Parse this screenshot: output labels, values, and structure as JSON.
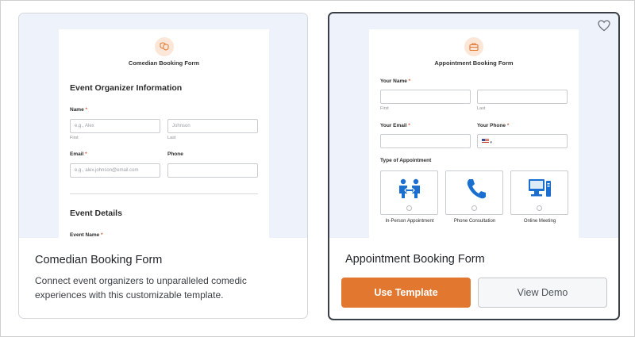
{
  "cards": [
    {
      "preview": {
        "form_title": "Comedian Booking Form",
        "section1": "Event Organizer Information",
        "name_label": "Name",
        "first_placeholder": "e.g., Alex",
        "last_placeholder": "Johnson",
        "first_sub": "First",
        "last_sub": "Last",
        "email_label": "Email",
        "email_placeholder": "e.g., alex.johnson@email.com",
        "phone_label": "Phone",
        "section2": "Event Details",
        "event_name_label": "Event Name",
        "required_mark": "*"
      },
      "title": "Comedian Booking Form",
      "description": "Connect event organizers to unparalleled comedic experiences with this customizable template."
    },
    {
      "preview": {
        "form_title": "Appointment Booking Form",
        "your_name_label": "Your Name",
        "first_sub": "First",
        "last_sub": "Last",
        "email_label": "Your Email",
        "phone_label": "Your Phone",
        "type_label": "Type of Appointment",
        "options": [
          "In-Person Appointment",
          "Phone Consultation",
          "Online Meeting"
        ],
        "required_mark": "*"
      },
      "title": "Appointment Booking Form",
      "use_template_label": "Use Template",
      "view_demo_label": "View Demo"
    }
  ],
  "colors": {
    "accent": "#e27730",
    "preview_bg": "#edf2fb",
    "icon_blue": "#1b6fd0"
  },
  "icons": [
    "theater-masks-icon",
    "briefcase-icon",
    "heart-icon",
    "handshake-icon",
    "phone-icon",
    "computer-icon",
    "us-flag-icon"
  ]
}
